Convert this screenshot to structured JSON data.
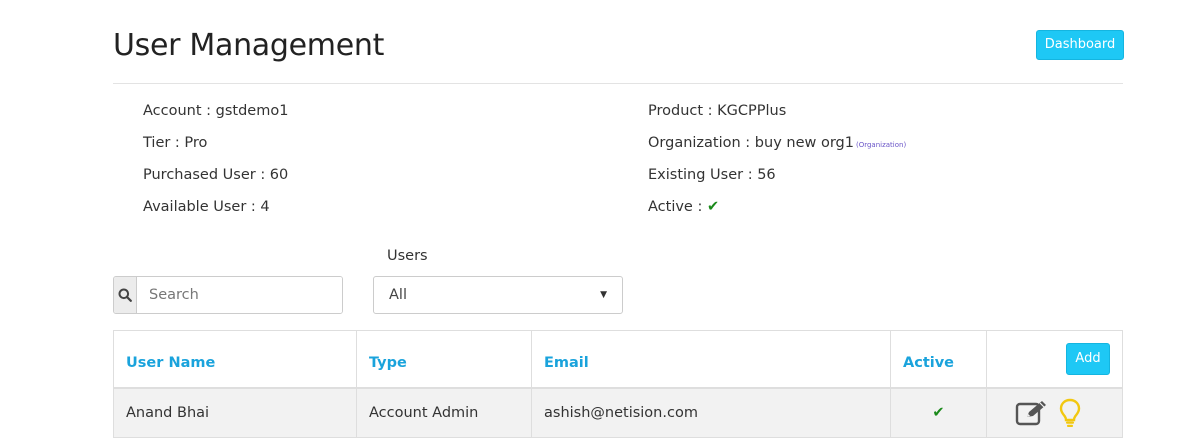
{
  "header": {
    "title": "User Management",
    "dashboard_label": "Dashboard"
  },
  "info": {
    "account": "Account : gstdemo1",
    "tier": "Tier : Pro",
    "purchased": "Purchased User : 60",
    "available": "Available User : 4",
    "product": "Product : KGCPPlus",
    "organization": "Organization : buy new org1",
    "organization_tag": "(Organization)",
    "existing": "Existing User : 56",
    "active_label": "Active :",
    "active_mark": "✔"
  },
  "filters": {
    "search_placeholder": "Search",
    "users_label": "Users",
    "users_selected": "All"
  },
  "table": {
    "headers": [
      "User Name",
      "Type",
      "Email",
      "Active"
    ],
    "add_label": "Add",
    "rows": [
      {
        "user_name": "Anand Bhai",
        "type": "Account Admin",
        "email": "ashish@netision.com",
        "active": "✔"
      }
    ]
  },
  "colors": {
    "accent": "#1ec8f5",
    "header_text": "#1aa3dc",
    "active_green": "#1a8a1a",
    "bulb": "#f2c811"
  },
  "icons": {
    "search": "search-icon",
    "edit": "edit-icon",
    "bulb": "lightbulb-icon",
    "check": "check-icon"
  }
}
